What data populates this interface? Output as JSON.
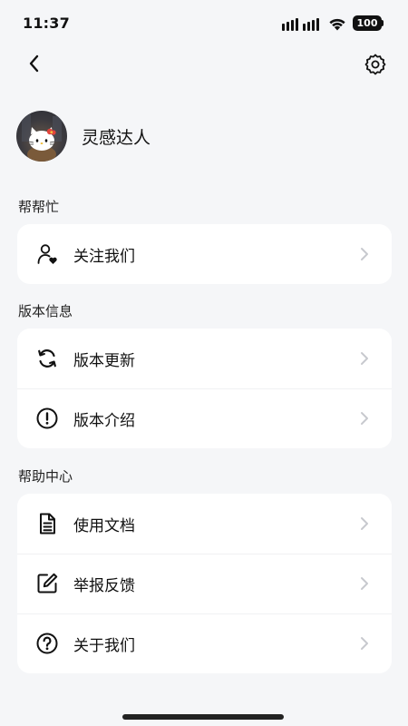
{
  "status_bar": {
    "time": "11:37",
    "battery": "100"
  },
  "nav": {
    "back_icon": "chevron-left-icon",
    "settings_icon": "gear-icon"
  },
  "profile": {
    "username": "灵感达人",
    "avatar_icon": "hello-kitty-avatar"
  },
  "sections": [
    {
      "title": "帮帮忙",
      "items": [
        {
          "label": "关注我们",
          "icon": "user-heart-icon"
        }
      ]
    },
    {
      "title": "版本信息",
      "items": [
        {
          "label": "版本更新",
          "icon": "refresh-icon"
        },
        {
          "label": "版本介绍",
          "icon": "alert-circle-icon"
        }
      ]
    },
    {
      "title": "帮助中心",
      "items": [
        {
          "label": "使用文档",
          "icon": "document-icon"
        },
        {
          "label": "举报反馈",
          "icon": "edit-icon"
        },
        {
          "label": "关于我们",
          "icon": "help-circle-icon"
        }
      ]
    }
  ],
  "colors": {
    "background": "#f5f6f8",
    "card": "#ffffff",
    "text": "#111111",
    "chevron": "#c7c9ce"
  }
}
